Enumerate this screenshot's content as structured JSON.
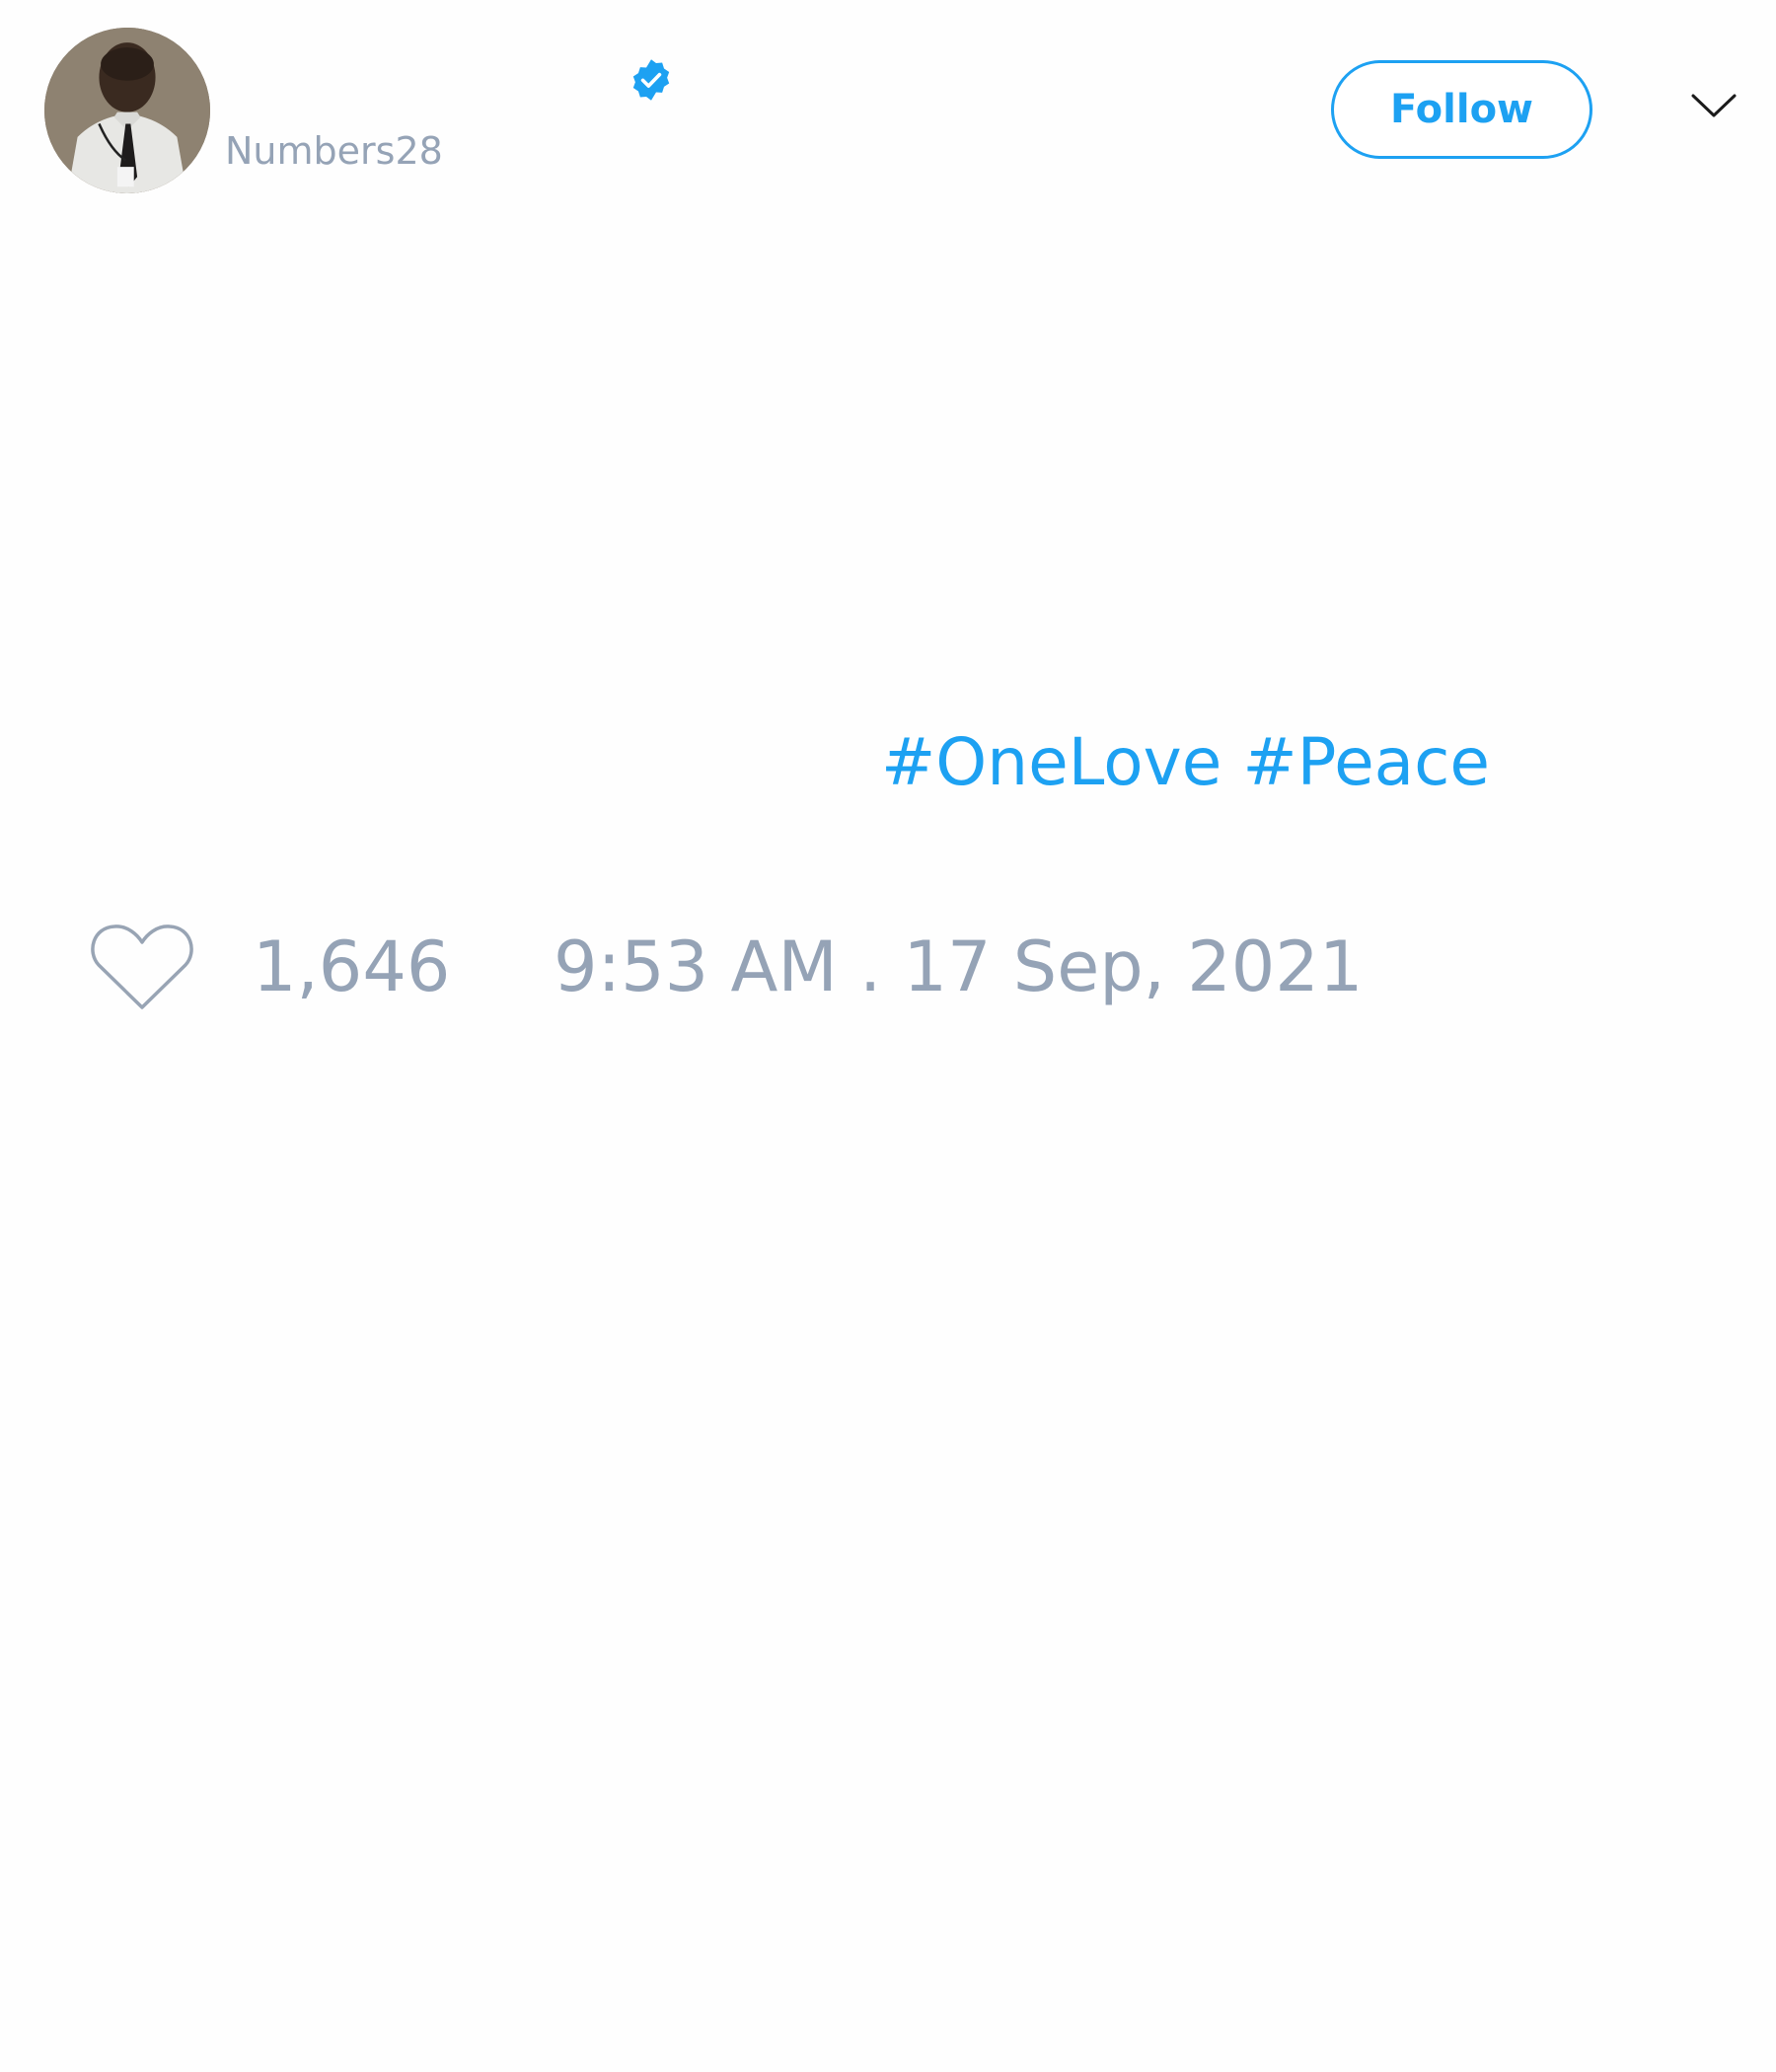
{
  "tweet": {
    "author": {
      "username": "Numbers28",
      "verified": true,
      "avatar": "profile-photo"
    },
    "follow_label": "Follow",
    "menu_icon": "chevron-down-icon",
    "hashtags": [
      "#OneLove",
      "#Peace"
    ],
    "likes": {
      "icon": "heart-icon",
      "count": "1,646"
    },
    "timestamp": "9:53 AM . 17 Sep, 2021"
  },
  "colors": {
    "accent": "#1da1f2",
    "muted_text": "#95a3b6",
    "background": "#ffffff"
  }
}
